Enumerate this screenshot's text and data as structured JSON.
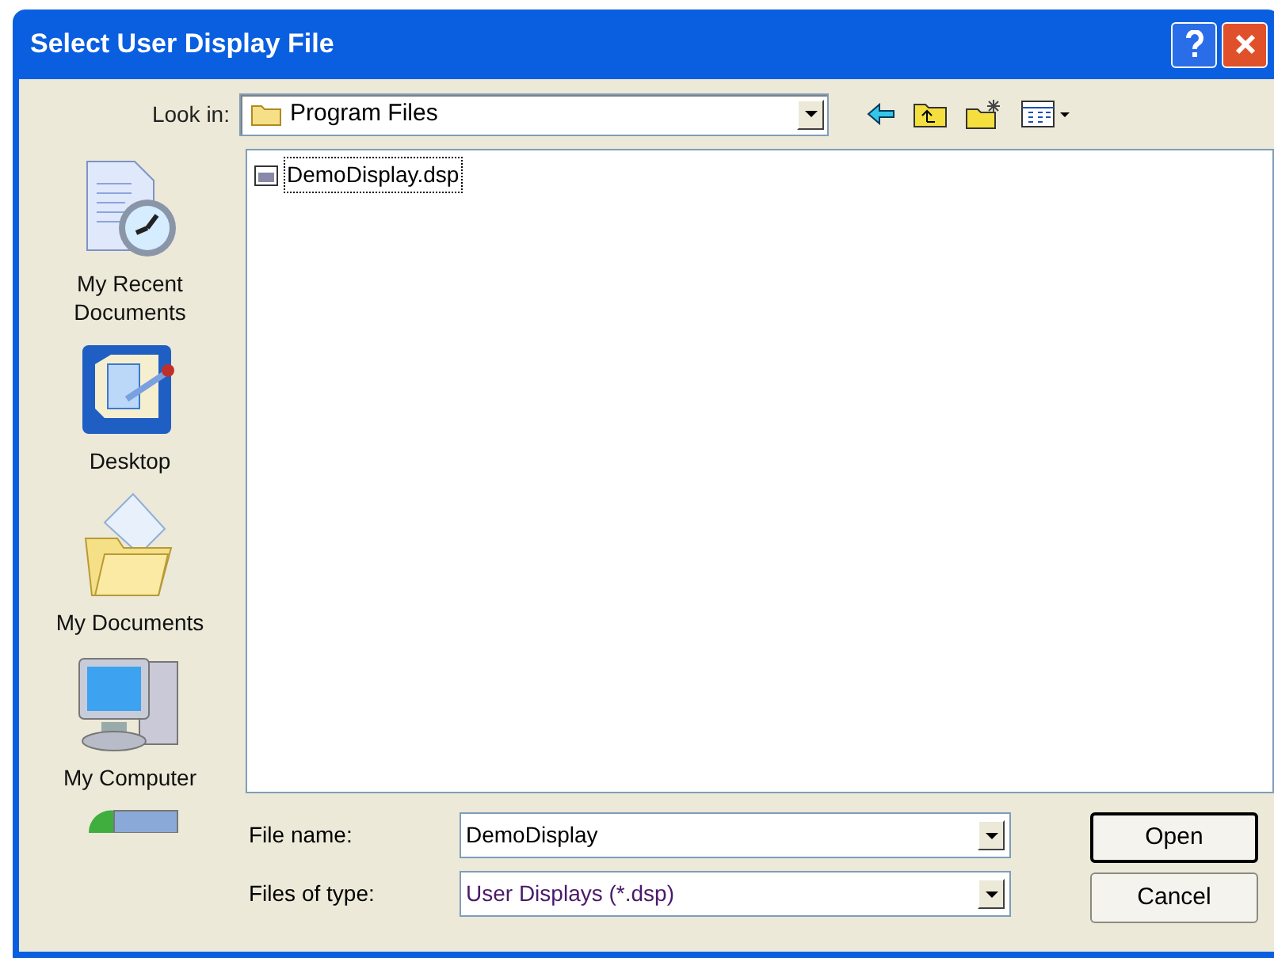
{
  "window": {
    "title": "Select User Display File"
  },
  "look_in": {
    "label": "Look in:",
    "value": "Program Files"
  },
  "places": [
    {
      "kind": "recent",
      "label": "My Recent Documents"
    },
    {
      "kind": "desktop",
      "label": "Desktop"
    },
    {
      "kind": "documents",
      "label": "My Documents"
    },
    {
      "kind": "computer",
      "label": "My Computer"
    },
    {
      "kind": "network"
    }
  ],
  "files": [
    {
      "name": "DemoDisplay.dsp",
      "focused": true
    }
  ],
  "file_name": {
    "label": "File name:",
    "value": "DemoDisplay"
  },
  "file_type": {
    "label": "Files of type:",
    "value": "User Displays (*.dsp)"
  },
  "buttons": [
    {
      "label": "Open",
      "default": true
    },
    {
      "label": "Cancel",
      "default": false
    }
  ]
}
